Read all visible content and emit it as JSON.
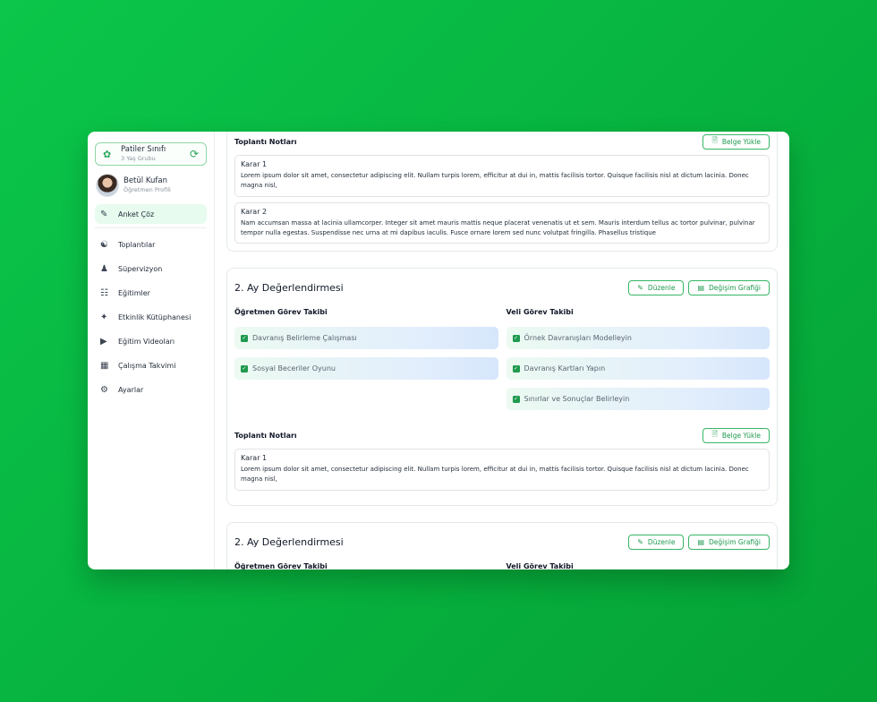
{
  "sidebar": {
    "class_card": {
      "name": "Patiler Sınıfı",
      "group": "3 Yaş Grubu"
    },
    "profile": {
      "name": "Betül Kufan",
      "role": "Öğretmen Profili"
    },
    "active_item": {
      "label": "Anket Çöz",
      "icon": "clipboard-edit-icon"
    },
    "items": [
      {
        "label": "Toplantılar",
        "icon": "users-icon"
      },
      {
        "label": "Süpervizyon",
        "icon": "user-group-icon"
      },
      {
        "label": "Eğitimler",
        "icon": "clipboard-icon"
      },
      {
        "label": "Etkinlik Kütüphanesi",
        "icon": "badge-icon"
      },
      {
        "label": "Eğitim Videoları",
        "icon": "video-icon"
      },
      {
        "label": "Çalışma Takvimi",
        "icon": "calendar-icon"
      },
      {
        "label": "Ayarlar",
        "icon": "gear-icon"
      }
    ]
  },
  "top_notes": {
    "title": "Toplantı Notları",
    "upload_label": "Belge Yükle",
    "notes": [
      {
        "title": "Karar 1",
        "body": "Lorem ipsum dolor sit amet, consectetur adipiscing elit. Nullam turpis lorem, efficitur at dui in, mattis facilisis tortor. Quisque facilisis nisl at dictum lacinia. Donec magna nisl,"
      },
      {
        "title": "Karar 2",
        "body": "Nam accumsan massa at lacinia ullamcorper. Integer sit amet mauris mattis neque placerat venenatis ut et sem. Mauris interdum tellus ac tortor pulvinar, pulvinar tempor nulla egestas. Suspendisse nec urna at mi dapibus iaculis. Fusce ornare lorem sed nunc volutpat fringilla. Phasellus tristique"
      }
    ]
  },
  "eval1": {
    "title": "2. Ay Değerlendirmesi",
    "edit_label": "Düzenle",
    "chart_label": "Değişim Grafiği",
    "teacher_title": "Öğretmen Görev Takibi",
    "parent_title": "Veli Görev Takibi",
    "teacher_tasks": [
      "Davranış Belirleme Çalışması",
      "Sosyal Beceriler Oyunu"
    ],
    "parent_tasks": [
      "Örnek Davranışları Modelleyin",
      "Davranış Kartları Yapın",
      "Sınırlar ve Sonuçlar Belirleyin"
    ],
    "notes_title": "Toplantı Notları",
    "upload_label": "Belge Yükle",
    "note": {
      "title": "Karar 1",
      "body": "Lorem ipsum dolor sit amet, consectetur adipiscing elit. Nullam turpis lorem, efficitur at dui in, mattis facilisis tortor. Quisque facilisis nisl at dictum lacinia. Donec magna nisl,"
    }
  },
  "eval2": {
    "title": "2. Ay Değerlendirmesi",
    "edit_label": "Düzenle",
    "chart_label": "Değişim Grafiği",
    "teacher_title": "Öğretmen Görev Takibi",
    "parent_title": "Veli Görev Takibi"
  },
  "colors": {
    "accent": "#1f9a4e",
    "active_bg": "#e7fbee",
    "background": "#07b540"
  }
}
